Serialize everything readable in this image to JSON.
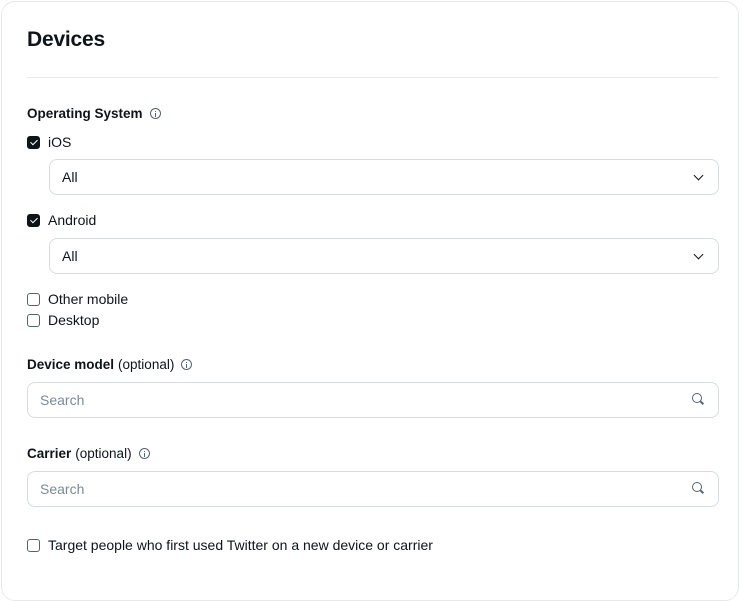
{
  "section": {
    "title": "Devices"
  },
  "operating_system": {
    "label": "Operating System",
    "options": [
      {
        "label": "iOS",
        "checked": true,
        "version_select": "All"
      },
      {
        "label": "Android",
        "checked": true,
        "version_select": "All"
      },
      {
        "label": "Other mobile",
        "checked": false
      },
      {
        "label": "Desktop",
        "checked": false
      }
    ]
  },
  "device_model": {
    "label": "Device model",
    "optional": "(optional)",
    "placeholder": "Search"
  },
  "carrier": {
    "label": "Carrier",
    "optional": "(optional)",
    "placeholder": "Search"
  },
  "new_device": {
    "label": "Target people who first used Twitter on a new device or carrier",
    "checked": false
  }
}
